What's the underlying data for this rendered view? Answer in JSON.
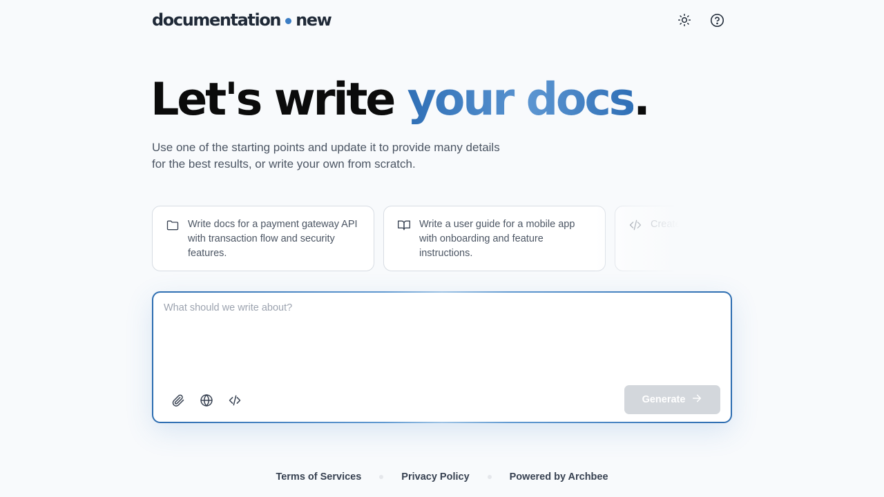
{
  "header": {
    "logo_left": "documentation",
    "logo_right": "new",
    "theme_icon": "sun-icon",
    "help_icon": "help-circle-icon"
  },
  "hero": {
    "lead": "Let's write ",
    "highlight": "your docs",
    "end": "."
  },
  "subtitle": {
    "line1": "Use one of the starting points and update it to provide many details",
    "line2": "for the best results, or write your own from scratch."
  },
  "suggestions": [
    {
      "icon": "folder-icon",
      "text": "Write docs for a payment gateway API with transaction flow and security features."
    },
    {
      "icon": "book-open-icon",
      "text": "Write a user guide for a mobile app with onboarding and feature instructions."
    },
    {
      "icon": "code-icon",
      "text": "Create API weather d authentica"
    }
  ],
  "composer": {
    "placeholder": "What should we write about?",
    "tools": [
      "paperclip-icon",
      "globe-icon",
      "code-icon"
    ],
    "generate_label": "Generate"
  },
  "footer": {
    "terms": "Terms of Services",
    "privacy": "Privacy Policy",
    "powered": "Powered by Archbee"
  },
  "colors": {
    "accent": "#3b7dc4",
    "background": "#f8fafc",
    "button_disabled": "#d3d7dc"
  }
}
